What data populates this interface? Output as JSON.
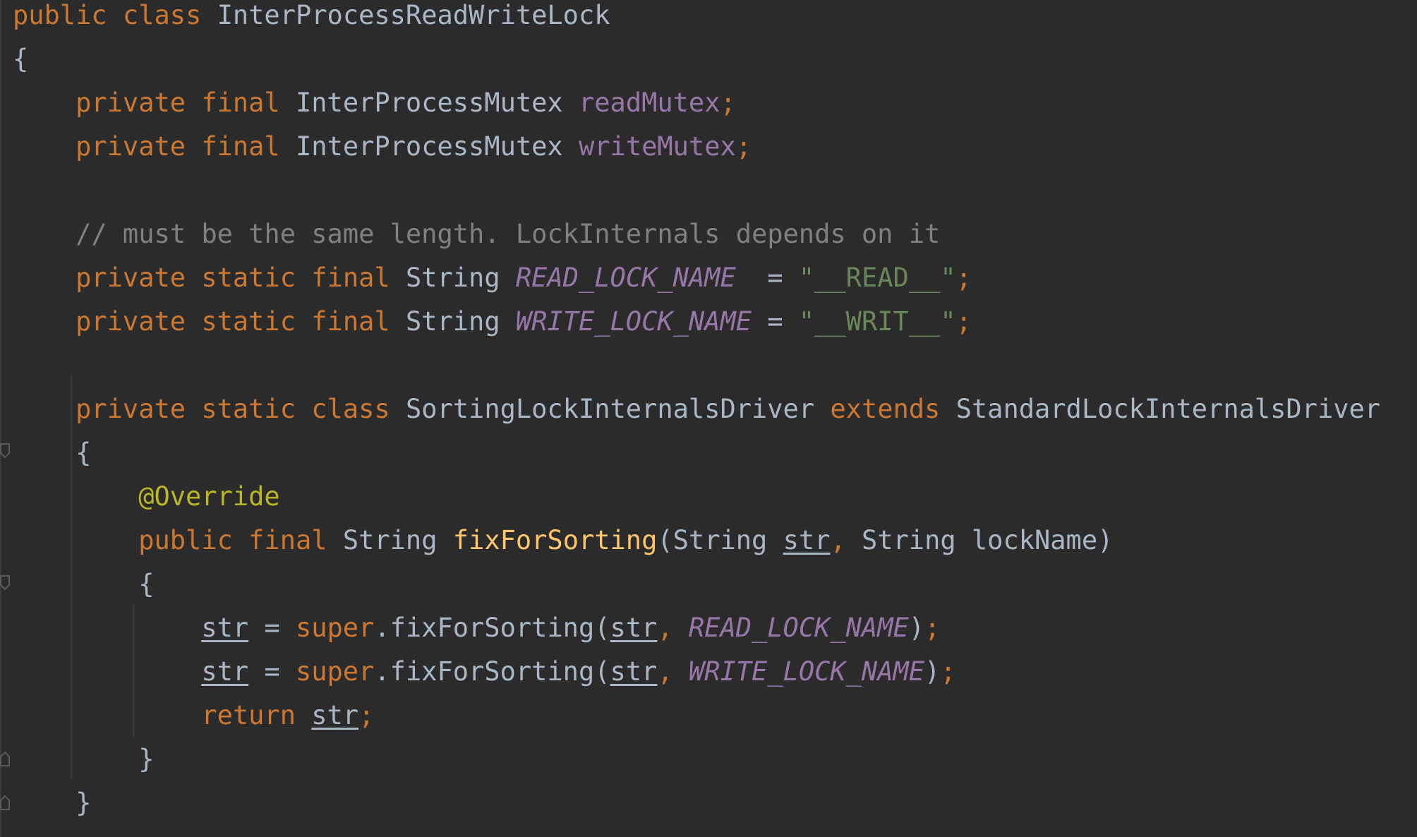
{
  "editor": {
    "colors": {
      "background": "#2b2b2b",
      "keyword": "#cc7832",
      "field": "#9876aa",
      "string": "#6a8759",
      "comment": "#808080",
      "annotation": "#bbb529",
      "method": "#ffc66d",
      "default": "#a9b7c6"
    },
    "tokens": {
      "public": "public",
      "class": "class",
      "private": "private",
      "final": "final",
      "static": "static",
      "extends": "extends",
      "super": "super",
      "return": "return",
      "class_name": "InterProcessReadWriteLock",
      "mutex_type": "InterProcessMutex",
      "read_mutex": "readMutex",
      "write_mutex": "writeMutex",
      "semicolon": ";",
      "open_brace": "{",
      "close_brace": "}",
      "comment": "// must be the same length. LockInternals depends on it",
      "string_type": "String",
      "read_lock_name": "READ_LOCK_NAME",
      "write_lock_name": "WRITE_LOCK_NAME",
      "eq_padded": "  = ",
      "eq": " = ",
      "read_lock_value": "\"__READ__\"",
      "write_lock_value": "\"__WRIT__\"",
      "inner_class_name": "SortingLockInternalsDriver",
      "base_class_name": "StandardLockInternalsDriver",
      "annotation": "@Override",
      "method_name": "fixForSorting",
      "open_paren": "(",
      "close_paren": ")",
      "comma": ",",
      "param_str": "str",
      "param_lock_name": "lockName",
      "dot_method": ".fixForSorting("
    }
  }
}
